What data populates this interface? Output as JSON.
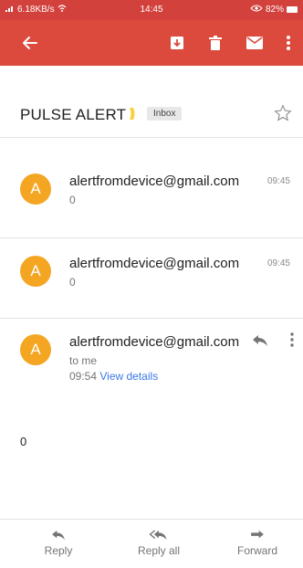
{
  "status_bar": {
    "signal_text": "6.18KB/s",
    "time": "14:45",
    "battery": "82%"
  },
  "toolbar": {
    "icons": [
      "back-arrow-icon",
      "archive-icon",
      "trash-icon",
      "mail-icon",
      "more-vert-icon"
    ]
  },
  "thread": {
    "subject": "PULSE ALERT",
    "label": "Inbox"
  },
  "messages": [
    {
      "avatar_letter": "A",
      "sender": "alertfromdevice@gmail.com",
      "snippet": "0",
      "time": "09:45"
    },
    {
      "avatar_letter": "A",
      "sender": "alertfromdevice@gmail.com",
      "snippet": "0",
      "time": "09:45"
    }
  ],
  "open_message": {
    "avatar_letter": "A",
    "sender": "alertfromdevice@gmail.com",
    "to": "to me",
    "time": "09:54",
    "view_details": "View details",
    "body": "0"
  },
  "bottom_actions": {
    "reply": "Reply",
    "reply_all": "Reply all",
    "forward": "Forward"
  },
  "colors": {
    "status_bar": "#d2413c",
    "toolbar": "#dc4a3d",
    "avatar": "#f4a623",
    "link": "#3b78e7"
  }
}
